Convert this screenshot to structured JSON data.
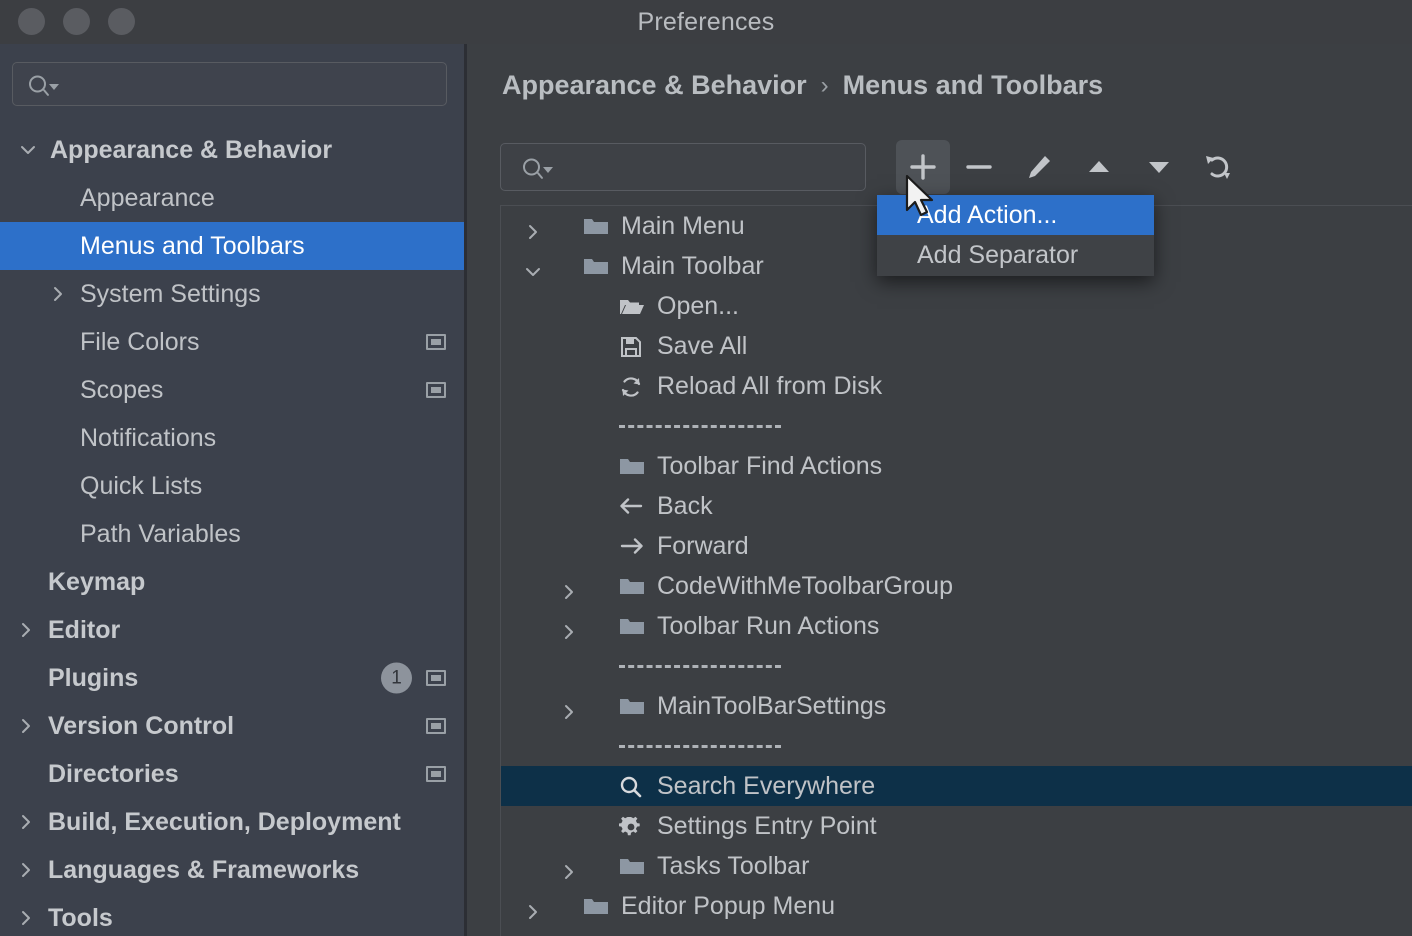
{
  "window": {
    "title": "Preferences",
    "traffic_lights": [
      "close-button",
      "minimize-button",
      "zoom-button"
    ]
  },
  "colors": {
    "accent_blue": "#2d70c9",
    "selection_inactive": "#0d3048",
    "sidebar_bg": "#3c414c",
    "main_bg": "#3c3f43",
    "text": "#c0c3c7",
    "badge_bg": "#8d939c"
  },
  "sidebar": {
    "search": {
      "placeholder": "",
      "value": "",
      "icon": "search-icon"
    },
    "items": [
      {
        "label": "Appearance & Behavior",
        "indent": 50,
        "arrow": "chevron-down",
        "bold": true,
        "selected": false,
        "badge": null,
        "scope": false
      },
      {
        "label": "Appearance",
        "indent": 80,
        "arrow": null,
        "bold": false,
        "selected": false,
        "badge": null,
        "scope": false
      },
      {
        "label": "Menus and Toolbars",
        "indent": 80,
        "arrow": null,
        "bold": false,
        "selected": true,
        "badge": null,
        "scope": false
      },
      {
        "label": "System Settings",
        "indent": 80,
        "arrow": "chevron-right",
        "bold": false,
        "selected": false,
        "badge": null,
        "scope": false
      },
      {
        "label": "File Colors",
        "indent": 80,
        "arrow": null,
        "bold": false,
        "selected": false,
        "badge": null,
        "scope": true
      },
      {
        "label": "Scopes",
        "indent": 80,
        "arrow": null,
        "bold": false,
        "selected": false,
        "badge": null,
        "scope": true
      },
      {
        "label": "Notifications",
        "indent": 80,
        "arrow": null,
        "bold": false,
        "selected": false,
        "badge": null,
        "scope": false
      },
      {
        "label": "Quick Lists",
        "indent": 80,
        "arrow": null,
        "bold": false,
        "selected": false,
        "badge": null,
        "scope": false
      },
      {
        "label": "Path Variables",
        "indent": 80,
        "arrow": null,
        "bold": false,
        "selected": false,
        "badge": null,
        "scope": false
      },
      {
        "label": "Keymap",
        "indent": 48,
        "arrow": null,
        "bold": true,
        "selected": false,
        "badge": null,
        "scope": false
      },
      {
        "label": "Editor",
        "indent": 48,
        "arrow": "chevron-right",
        "bold": true,
        "selected": false,
        "badge": null,
        "scope": false
      },
      {
        "label": "Plugins",
        "indent": 48,
        "arrow": null,
        "bold": true,
        "selected": false,
        "badge": "1",
        "scope": true
      },
      {
        "label": "Version Control",
        "indent": 48,
        "arrow": "chevron-right",
        "bold": true,
        "selected": false,
        "badge": null,
        "scope": true
      },
      {
        "label": "Directories",
        "indent": 48,
        "arrow": null,
        "bold": true,
        "selected": false,
        "badge": null,
        "scope": true
      },
      {
        "label": "Build, Execution, Deployment",
        "indent": 48,
        "arrow": "chevron-right",
        "bold": true,
        "selected": false,
        "badge": null,
        "scope": false
      },
      {
        "label": "Languages & Frameworks",
        "indent": 48,
        "arrow": "chevron-right",
        "bold": true,
        "selected": false,
        "badge": null,
        "scope": false
      },
      {
        "label": "Tools",
        "indent": 48,
        "arrow": "chevron-right",
        "bold": true,
        "selected": false,
        "badge": null,
        "scope": false
      }
    ]
  },
  "main": {
    "breadcrumb": {
      "root": "Appearance & Behavior",
      "separator": "›",
      "leaf": "Menus and Toolbars"
    },
    "search": {
      "placeholder": "",
      "value": "",
      "icon": "search-icon"
    },
    "toolbar_buttons": [
      {
        "name": "add-button",
        "icon": "plus-icon",
        "active": true
      },
      {
        "name": "remove-button",
        "icon": "minus-icon",
        "active": false
      },
      {
        "name": "edit-button",
        "icon": "pencil-icon",
        "active": false
      },
      {
        "name": "move-up-button",
        "icon": "triangle-up-icon",
        "active": false
      },
      {
        "name": "move-down-button",
        "icon": "triangle-down-icon",
        "active": false
      },
      {
        "name": "restore-button",
        "icon": "revert-arrow-icon",
        "active": false
      }
    ],
    "tree": [
      {
        "label": "Main Menu",
        "depth": 0,
        "arrow": "chevron-right",
        "icon": "folder-icon",
        "selected": false,
        "type": "node"
      },
      {
        "label": "Main Toolbar",
        "depth": 0,
        "arrow": "chevron-down",
        "icon": "folder-icon",
        "selected": false,
        "type": "node"
      },
      {
        "label": "Open...",
        "depth": 1,
        "arrow": null,
        "icon": "open-folder-icon",
        "selected": false,
        "type": "leaf"
      },
      {
        "label": "Save All",
        "depth": 1,
        "arrow": null,
        "icon": "save-icon",
        "selected": false,
        "type": "leaf"
      },
      {
        "label": "Reload All from Disk",
        "depth": 1,
        "arrow": null,
        "icon": "reload-icon",
        "selected": false,
        "type": "leaf"
      },
      {
        "label": "",
        "depth": 1,
        "arrow": null,
        "icon": null,
        "selected": false,
        "type": "separator"
      },
      {
        "label": "Toolbar Find Actions",
        "depth": 1,
        "arrow": null,
        "icon": "folder-icon",
        "selected": false,
        "type": "node"
      },
      {
        "label": "Back",
        "depth": 1,
        "arrow": null,
        "icon": "arrow-left-icon",
        "selected": false,
        "type": "leaf"
      },
      {
        "label": "Forward",
        "depth": 1,
        "arrow": null,
        "icon": "arrow-right-icon",
        "selected": false,
        "type": "leaf"
      },
      {
        "label": "CodeWithMeToolbarGroup",
        "depth": 1,
        "arrow": "chevron-right",
        "icon": "folder-icon",
        "selected": false,
        "type": "node"
      },
      {
        "label": "Toolbar Run Actions",
        "depth": 1,
        "arrow": "chevron-right",
        "icon": "folder-icon",
        "selected": false,
        "type": "node"
      },
      {
        "label": "",
        "depth": 1,
        "arrow": null,
        "icon": null,
        "selected": false,
        "type": "separator"
      },
      {
        "label": "MainToolBarSettings",
        "depth": 1,
        "arrow": "chevron-right",
        "icon": "folder-icon",
        "selected": false,
        "type": "node"
      },
      {
        "label": "",
        "depth": 1,
        "arrow": null,
        "icon": null,
        "selected": false,
        "type": "separator"
      },
      {
        "label": "Search Everywhere",
        "depth": 1,
        "arrow": null,
        "icon": "search-icon",
        "selected": true,
        "type": "leaf"
      },
      {
        "label": "Settings Entry Point",
        "depth": 1,
        "arrow": null,
        "icon": "gear-icon",
        "selected": false,
        "type": "leaf"
      },
      {
        "label": "Tasks Toolbar",
        "depth": 1,
        "arrow": "chevron-right",
        "icon": "folder-icon",
        "selected": false,
        "type": "node"
      },
      {
        "label": "Editor Popup Menu",
        "depth": 0,
        "arrow": "chevron-right",
        "icon": "folder-icon",
        "selected": false,
        "type": "node"
      }
    ]
  },
  "dropdown": {
    "items": [
      {
        "label": "Add Action...",
        "highlighted": true
      },
      {
        "label": "Add Separator",
        "highlighted": false
      }
    ]
  }
}
